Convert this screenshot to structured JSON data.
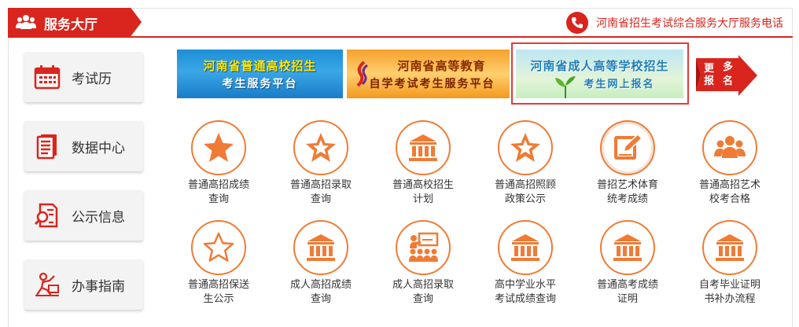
{
  "header": {
    "title": "服务大厅",
    "hotline": "河南省招生考试综合服务大厅服务电话"
  },
  "sidebar": {
    "items": [
      {
        "label": "考试历",
        "icon": "calendar-icon"
      },
      {
        "label": "数据中心",
        "icon": "document-icon"
      },
      {
        "label": "公示信息",
        "icon": "search-document-icon"
      },
      {
        "label": "办事指南",
        "icon": "person-guide-icon"
      }
    ]
  },
  "banners": [
    {
      "line1": "河南省普通高校招生",
      "line2": "考生服务平台"
    },
    {
      "line1": "河南省高等教育",
      "line2": "自学考试考生服务平台"
    },
    {
      "line1": "河南省成人高等学校招生",
      "line2": "考生网上报名"
    }
  ],
  "more": {
    "c1": "更",
    "c2": "多",
    "c3": "报",
    "c4": "名"
  },
  "services": [
    {
      "line1": "普通高招成绩",
      "line2": "查询",
      "icon": "star-filled-icon"
    },
    {
      "line1": "普通高招录取",
      "line2": "查询",
      "icon": "star-double-icon"
    },
    {
      "line1": "普通高校招生",
      "line2": "计划",
      "icon": "building-icon"
    },
    {
      "line1": "普通高招照顾",
      "line2": "政策公示",
      "icon": "star-double-icon"
    },
    {
      "line1": "普招艺术体育",
      "line2": "统考成绩",
      "icon": "edit-icon"
    },
    {
      "line1": "普通高招艺术",
      "line2": "校考合格",
      "icon": "group-icon"
    },
    {
      "line1": "普通高招保送",
      "line2": "生公示",
      "icon": "star-outline-icon"
    },
    {
      "line1": "成人高招成绩",
      "line2": "查询",
      "icon": "building-icon"
    },
    {
      "line1": "成人高招录取",
      "line2": "查询",
      "icon": "presentation-icon"
    },
    {
      "line1": "高中学业水平",
      "line2": "考试成绩查询",
      "icon": "building-icon"
    },
    {
      "line1": "普通高考成绩",
      "line2": "证明",
      "icon": "building-icon"
    },
    {
      "line1": "自考毕业证明",
      "line2": "书补办流程",
      "icon": "building-icon"
    }
  ],
  "colors": {
    "accent": "#d9251d",
    "icon": "#f07b34"
  }
}
